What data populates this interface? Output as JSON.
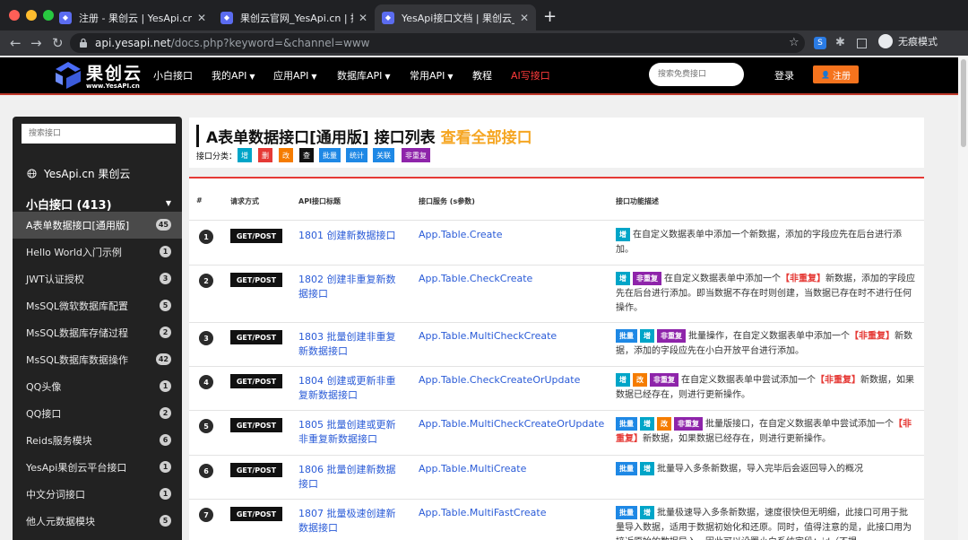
{
  "browser": {
    "tabs": [
      {
        "title": "注册 - 果创云 | YesApi.cn",
        "active": false
      },
      {
        "title": "果创云官网_YesApi.cn | 接口云...",
        "active": false
      },
      {
        "title": "YesApi接口文档 | 果创云_数据库...",
        "active": true
      }
    ],
    "url_host": "api.yesapi.net",
    "url_path": "/docs.php?keyword=&channel=www",
    "incognito_label": "无痕模式"
  },
  "header": {
    "brand": "果创云",
    "brand_sub": "www.YesAPI.cn",
    "menu": [
      {
        "label": "小白接口",
        "dropdown": false
      },
      {
        "label": "我的API",
        "dropdown": true
      },
      {
        "label": "应用API",
        "dropdown": true
      },
      {
        "label": "数据库API",
        "dropdown": true
      },
      {
        "label": "常用API",
        "dropdown": true
      },
      {
        "label": "教程",
        "dropdown": false
      },
      {
        "label": "AI写接口",
        "dropdown": false
      }
    ],
    "search_placeholder": "搜索免费接口",
    "login": "登录",
    "register": "注册"
  },
  "sidebar": {
    "search_placeholder": "搜索接口",
    "brand": "YesApi.cn 果创云",
    "group": "小白接口 (413)",
    "items": [
      {
        "label": "A表单数据接口[通用版]",
        "count": "45",
        "active": true
      },
      {
        "label": "Hello World入门示例",
        "count": "1"
      },
      {
        "label": "JWT认证授权",
        "count": "3"
      },
      {
        "label": "MsSQL微软数据库配置",
        "count": "5"
      },
      {
        "label": "MsSQL数据库存储过程",
        "count": "2"
      },
      {
        "label": "MsSQL数据库数据操作",
        "count": "42"
      },
      {
        "label": "QQ头像",
        "count": "1"
      },
      {
        "label": "QQ接口",
        "count": "2"
      },
      {
        "label": "Reids服务模块",
        "count": "6"
      },
      {
        "label": "YesApi果创云平台接口",
        "count": "1"
      },
      {
        "label": "中文分词接口",
        "count": "1"
      },
      {
        "label": "他人元数据模块",
        "count": "5"
      }
    ]
  },
  "main": {
    "title": "A表单数据接口[通用版] 接口列表",
    "view_all": "查看全部接口",
    "category_label": "接口分类：",
    "categories": [
      {
        "label": "增",
        "color": "#00a5c8"
      },
      {
        "label": "删",
        "color": "#e53935"
      },
      {
        "label": "改",
        "color": "#f57c00"
      },
      {
        "label": "查",
        "color": "#111111"
      },
      {
        "label": "批量",
        "color": "#1e88e5"
      },
      {
        "label": "统计",
        "color": "#1e88e5"
      },
      {
        "label": "关联",
        "color": "#1e88e5"
      },
      {
        "label": "非重复",
        "color": "#8e24aa"
      }
    ],
    "columns": [
      "#",
      "请求方式",
      "API接口标题",
      "接口服务 (s参数)",
      "接口功能描述"
    ],
    "rows": [
      {
        "num": "1",
        "method": "GET/POST",
        "title": "1801 创建新数据接口",
        "service": "App.Table.Create",
        "tags": [
          {
            "label": "增",
            "color": "#00a5c8"
          }
        ],
        "desc": [
          {
            "t": "在自定义数据表单中添加一个新数据，添加的字段应先在后台进行添加。"
          }
        ]
      },
      {
        "num": "2",
        "method": "GET/POST",
        "title": "1802 创建非重复新数据接口",
        "service": "App.Table.CheckCreate",
        "tags": [
          {
            "label": "增",
            "color": "#00a5c8"
          },
          {
            "label": "非重复",
            "color": "#8e24aa"
          }
        ],
        "desc": [
          {
            "t": "在自定义数据表单中添加一个"
          },
          {
            "t": "【非重复】",
            "e": true
          },
          {
            "t": "新数据，添加的字段应先在后台进行添加。即当数据不存在时则创建，当数据已存在时不进行任何操作。"
          }
        ]
      },
      {
        "num": "3",
        "method": "GET/POST",
        "title": "1803 批量创建非重复新数据接口",
        "service": "App.Table.MultiCheckCreate",
        "tags": [
          {
            "label": "批量",
            "color": "#1e88e5"
          },
          {
            "label": "增",
            "color": "#00a5c8"
          },
          {
            "label": "非重复",
            "color": "#8e24aa"
          }
        ],
        "desc": [
          {
            "t": "批量操作，在自定义数据表单中添加一个"
          },
          {
            "t": "【非重复】",
            "e": true
          },
          {
            "t": "新数据，添加的字段应先在小白开放平台进行添加。"
          }
        ]
      },
      {
        "num": "4",
        "method": "GET/POST",
        "title": "1804 创建或更新非重复新数据接口",
        "service": "App.Table.CheckCreateOrUpdate",
        "tags": [
          {
            "label": "增",
            "color": "#00a5c8"
          },
          {
            "label": "改",
            "color": "#f57c00"
          },
          {
            "label": "非重复",
            "color": "#8e24aa"
          }
        ],
        "desc": [
          {
            "t": "在自定义数据表单中尝试添加一个"
          },
          {
            "t": "【非重复】",
            "e": true
          },
          {
            "t": "新数据，如果数据已经存在，则进行更新操作。"
          }
        ]
      },
      {
        "num": "5",
        "method": "GET/POST",
        "title": "1805 批量创建或更新非重复新数据接口",
        "service": "App.Table.MultiCheckCreateOrUpdate",
        "tags": [
          {
            "label": "批量",
            "color": "#1e88e5"
          },
          {
            "label": "增",
            "color": "#00a5c8"
          },
          {
            "label": "改",
            "color": "#f57c00"
          },
          {
            "label": "非重复",
            "color": "#8e24aa"
          }
        ],
        "desc": [
          {
            "t": "批量版接口，在自定义数据表单中尝试添加一个"
          },
          {
            "t": "【非重复】",
            "e": true
          },
          {
            "t": "新数据，如果数据已经存在，则进行更新操作。"
          }
        ]
      },
      {
        "num": "6",
        "method": "GET/POST",
        "title": "1806 批量创建新数据接口",
        "service": "App.Table.MultiCreate",
        "tags": [
          {
            "label": "批量",
            "color": "#1e88e5"
          },
          {
            "label": "增",
            "color": "#00a5c8"
          }
        ],
        "desc": [
          {
            "t": "批量导入多条新数据，导入完毕后会返回导入的概况"
          }
        ]
      },
      {
        "num": "7",
        "method": "GET/POST",
        "title": "1807 批量极速创建新数据接口",
        "service": "App.Table.MultiFastCreate",
        "tags": [
          {
            "label": "批量",
            "color": "#1e88e5"
          },
          {
            "label": "增",
            "color": "#00a5c8"
          }
        ],
        "desc": [
          {
            "t": "批量极速导入多条新数据，速度很快但无明细，此接口可用于批量导入数据，适用于数据初始化和还原。同时，值得注意的是，此接口用为接近原始的数据导入，因此可以设置小白系统字段：id（不提"
          }
        ]
      }
    ]
  }
}
